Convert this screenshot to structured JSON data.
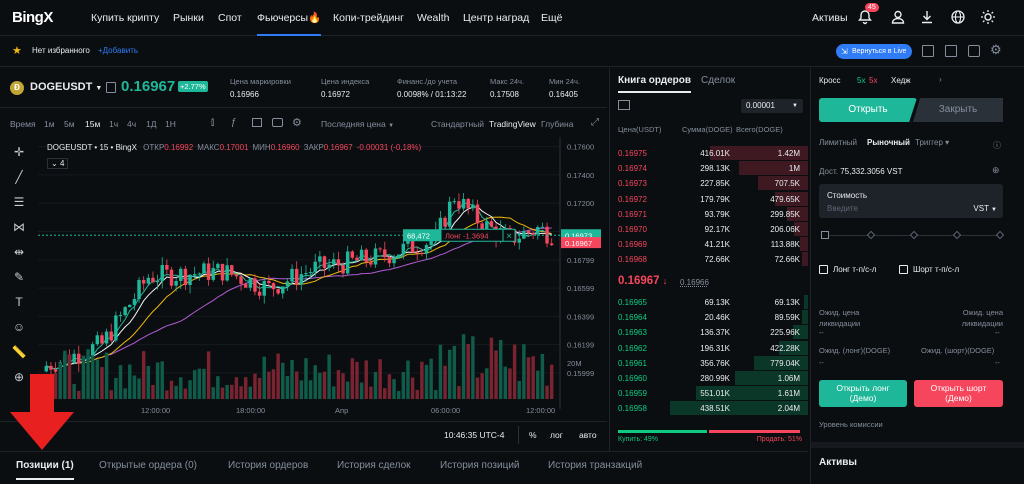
{
  "app": {
    "logo": "BingX"
  },
  "nav": {
    "items": [
      "Купить крипту",
      "Рынки",
      "Спот",
      "Фьючерсы🔥",
      "Копи-трейдинг",
      "Wealth",
      "Центр наград",
      "Ещё"
    ],
    "active": "Фьючерсы🔥",
    "assets": "Активы",
    "notif_count": "45"
  },
  "sub": {
    "fav_text": "Нет избранного",
    "add_fav": "+Добавить",
    "back_button": "Вернуться в Live"
  },
  "ticker": {
    "symbol": "DOGEUSDT",
    "price": "0.16967",
    "change": "+2.77%",
    "stats": [
      {
        "label": "Цена маркировки",
        "value": "0.16966"
      },
      {
        "label": "Цена индекса",
        "value": "0.16972"
      },
      {
        "label": "Финанс./до учета",
        "value": "0.0098% / 01:13:22"
      },
      {
        "label": "Макс 24ч.",
        "value": "0.17508"
      },
      {
        "label": "Мин 24ч.",
        "value": "0.16405"
      }
    ]
  },
  "chart_toolbar": {
    "time_label": "Время",
    "intervals": [
      "1м",
      "5м",
      "15м",
      "1ч",
      "4ч",
      "1Д",
      "1Н"
    ],
    "active_interval": "15м",
    "price_type": "Последняя цена",
    "views": [
      "Стандартный",
      "TradingView",
      "Глубина"
    ],
    "active_view": "TradingView"
  },
  "chart": {
    "legend": "DOGEUSDT • 15 • BingX",
    "ohlc": [
      {
        "k": "ОТКР",
        "v": "0.16992"
      },
      {
        "k": "МАКС",
        "v": "0.17001"
      },
      {
        "k": "МИН",
        "v": "0.16960"
      },
      {
        "k": "ЗАКР",
        "v": "0.16967"
      },
      {
        "k": "",
        "v": "-0.00031 (-0,18%)"
      }
    ],
    "indicator_count": "4",
    "position_qty": "68,472",
    "position_label": "Лонг -1.3694",
    "tag_close": "✕",
    "price_tag_1": "0.16973",
    "price_tag_2": "0.16967",
    "volume_label": "20M",
    "bottom_time": "10:46:35 UTC-4",
    "bottom_pct": "%",
    "bottom_log": "лог",
    "bottom_auto": "авто"
  },
  "chart_data": {
    "type": "candlestick",
    "y_ticks": [
      "0.17600",
      "0.17400",
      "0.17200",
      "0.17000",
      "0.16799",
      "0.16599",
      "0.16399",
      "0.16199",
      "0.15999"
    ],
    "x_ticks": [
      "12:00:00",
      "18:00:00",
      "Апр",
      "06:00:00",
      "12:00:00"
    ],
    "y_range": [
      0.1597,
      0.1764
    ]
  },
  "orderbook": {
    "tabs": [
      "Книга ордеров",
      "Сделок"
    ],
    "active_tab": "Книга ордеров",
    "precision": "0.00001",
    "headers": [
      "Цена(USDT)",
      "Сумма(DOGE)",
      "Всего(DOGE)"
    ],
    "asks": [
      {
        "p": "0.16975",
        "a": "416.01K",
        "t": "1.42M",
        "d": 0.71
      },
      {
        "p": "0.16974",
        "a": "298.13K",
        "t": "1M",
        "d": 0.5
      },
      {
        "p": "0.16973",
        "a": "227.85K",
        "t": "707.5K",
        "d": 0.36
      },
      {
        "p": "0.16972",
        "a": "179.79K",
        "t": "479.65K",
        "d": 0.24
      },
      {
        "p": "0.16971",
        "a": "93.79K",
        "t": "299.85K",
        "d": 0.15
      },
      {
        "p": "0.16970",
        "a": "92.17K",
        "t": "206.06K",
        "d": 0.1
      },
      {
        "p": "0.16969",
        "a": "41.21K",
        "t": "113.88K",
        "d": 0.06
      },
      {
        "p": "0.16968",
        "a": "72.66K",
        "t": "72.66K",
        "d": 0.04
      }
    ],
    "last_price": "0.16967",
    "mark": "0.16966",
    "bids": [
      {
        "p": "0.16965",
        "a": "69.13K",
        "t": "69.13K",
        "d": 0.03
      },
      {
        "p": "0.16964",
        "a": "20.46K",
        "t": "89.59K",
        "d": 0.04
      },
      {
        "p": "0.16963",
        "a": "136.37K",
        "t": "225.96K",
        "d": 0.11
      },
      {
        "p": "0.16962",
        "a": "196.31K",
        "t": "422.28K",
        "d": 0.21
      },
      {
        "p": "0.16961",
        "a": "356.76K",
        "t": "779.04K",
        "d": 0.39
      },
      {
        "p": "0.16960",
        "a": "280.99K",
        "t": "1.06M",
        "d": 0.53
      },
      {
        "p": "0.16959",
        "a": "551.01K",
        "t": "1.61M",
        "d": 0.81
      },
      {
        "p": "0.16958",
        "a": "438.51K",
        "t": "2.04M",
        "d": 1.0
      }
    ],
    "buy_pct": "Купить: 49%",
    "sell_pct": "Продать: 51%",
    "buy_ratio": 0.49
  },
  "trade": {
    "margin_mode": "Кросс",
    "lev_long": "5x",
    "lev_short": "5x",
    "hedge": "Хедж",
    "open_tab": "Открыть",
    "close_tab": "Закрыть",
    "order_types": [
      "Лимитный",
      "Рыночный",
      "Триггер"
    ],
    "active_type": "Рыночный",
    "avail_label": "Дост.",
    "avail_value": "75,332.3056 VST",
    "cost_label": "Стоимость",
    "cost_placeholder": "Введите",
    "currency": "VST",
    "tp_sl_long": "Лонг т-п/с-л",
    "tp_sl_short": "Шорт т-п/с-л",
    "liq_long": "Ожид. цена ликвидации",
    "liq_short": "Ожид. цена ликвидации",
    "dash": "--",
    "long_qty_label": "Ожид. (лонг)(DOGE)",
    "short_qty_label": "Ожид. (шорт)(DOGE)",
    "open_long": "Открыть лонг (Демо)",
    "open_short": "Открыть шорт (Демо)",
    "fee_level": "Уровень комиссии",
    "assets_title": "Активы"
  },
  "bottom": {
    "tabs": [
      "Позиции (1)",
      "Открытые ордера (0)",
      "История ордеров",
      "История сделок",
      "История позиций",
      "История транзакций"
    ]
  },
  "colors": {
    "green": "#0ecb81",
    "red": "#f6465d",
    "teal": "#1fb79a",
    "accent": "#2f7cf6"
  }
}
